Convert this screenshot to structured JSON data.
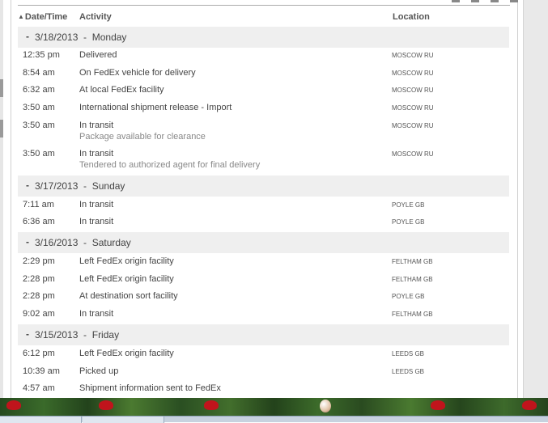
{
  "table": {
    "headers": {
      "datetime": "Date/Time",
      "activity": "Activity",
      "location": "Location"
    },
    "sort_icon": "triangle-up-icon",
    "days": [
      {
        "date": "3/18/2013",
        "weekday": "Monday",
        "events": [
          {
            "time": "12:35 pm",
            "activity": "Delivered",
            "note": "",
            "location": "MOSCOW RU"
          },
          {
            "time": "8:54 am",
            "activity": "On FedEx vehicle for delivery",
            "note": "",
            "location": "MOSCOW RU"
          },
          {
            "time": "6:32 am",
            "activity": "At local FedEx facility",
            "note": "",
            "location": "MOSCOW RU"
          },
          {
            "time": "3:50 am",
            "activity": "International shipment release - Import",
            "note": "",
            "location": "MOSCOW RU"
          },
          {
            "time": "3:50 am",
            "activity": "In transit",
            "note": "Package available for clearance",
            "location": "MOSCOW RU"
          },
          {
            "time": "3:50 am",
            "activity": "In transit",
            "note": "Tendered to authorized agent for final delivery",
            "location": "MOSCOW RU"
          }
        ]
      },
      {
        "date": "3/17/2013",
        "weekday": "Sunday",
        "events": [
          {
            "time": "7:11 am",
            "activity": "In transit",
            "note": "",
            "location": "POYLE GB"
          },
          {
            "time": "6:36 am",
            "activity": "In transit",
            "note": "",
            "location": "POYLE GB"
          }
        ]
      },
      {
        "date": "3/16/2013",
        "weekday": "Saturday",
        "events": [
          {
            "time": "2:29 pm",
            "activity": "Left FedEx origin facility",
            "note": "",
            "location": "FELTHAM GB"
          },
          {
            "time": "2:28 pm",
            "activity": "Left FedEx origin facility",
            "note": "",
            "location": "FELTHAM GB"
          },
          {
            "time": "2:28 pm",
            "activity": "At destination sort facility",
            "note": "",
            "location": "POYLE GB"
          },
          {
            "time": "9:02 am",
            "activity": "In transit",
            "note": "",
            "location": "FELTHAM GB"
          }
        ]
      },
      {
        "date": "3/15/2013",
        "weekday": "Friday",
        "events": [
          {
            "time": "6:12 pm",
            "activity": "Left FedEx origin facility",
            "note": "",
            "location": "LEEDS GB"
          },
          {
            "time": "10:39 am",
            "activity": "Picked up",
            "note": "",
            "location": "LEEDS GB"
          },
          {
            "time": "4:57 am",
            "activity": "Shipment information sent to FedEx",
            "note": "",
            "location": ""
          }
        ]
      }
    ]
  },
  "colors": {
    "day_header_bg": "#efefef",
    "text": "#444444",
    "note": "#888888"
  }
}
